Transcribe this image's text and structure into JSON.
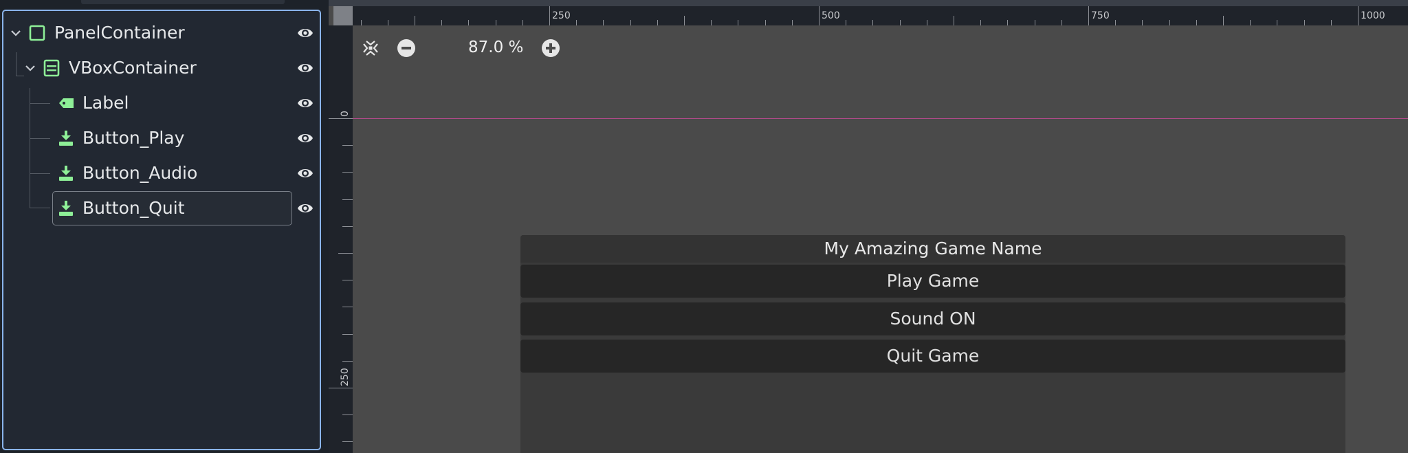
{
  "scene_tree": {
    "nodes": [
      {
        "label": "PanelContainer",
        "icon": "panel-container-icon"
      },
      {
        "label": "VBoxContainer",
        "icon": "vbox-container-icon"
      },
      {
        "label": "Label",
        "icon": "label-node-icon"
      },
      {
        "label": "Button_Play",
        "icon": "button-node-icon"
      },
      {
        "label": "Button_Audio",
        "icon": "button-node-icon"
      },
      {
        "label": "Button_Quit",
        "icon": "button-node-icon"
      }
    ],
    "selected": "Button_Quit"
  },
  "viewport": {
    "zoom_label": "87.0 %",
    "ruler_h_labels": [
      "250",
      "500",
      "750",
      "1000"
    ],
    "ruler_v_labels": [
      "0",
      "250"
    ]
  },
  "game_ui": {
    "title": "My Amazing Game Name",
    "buttons": [
      "Play Game",
      "Sound ON",
      "Quit Game"
    ]
  },
  "colors": {
    "accent": "#8ab4ec",
    "node_green": "#8eef97",
    "origin_line": "#b14a8a"
  }
}
